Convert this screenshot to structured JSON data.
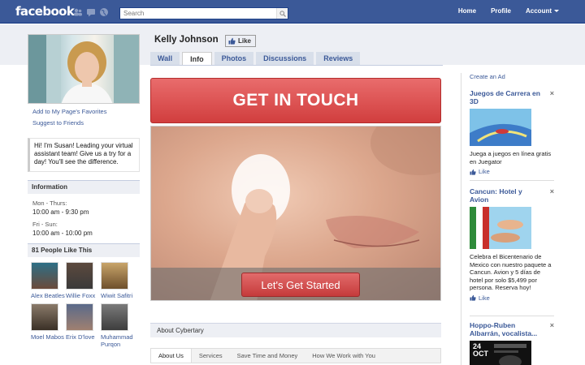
{
  "topbar": {
    "logo": "facebook",
    "search_placeholder": "Search",
    "nav": [
      "Home",
      "Profile",
      "Account"
    ]
  },
  "page": {
    "name": "Kelly Johnson",
    "like_label": "Like",
    "tabs": [
      "Wall",
      "Info",
      "Photos",
      "Discussions",
      "Reviews"
    ],
    "active_tab": "Info"
  },
  "left": {
    "links": [
      "Add to My Page's Favorites",
      "Suggest to Friends"
    ],
    "bio": "Hi! I'm Susan! Leading your virtual assistant team! Give us a try for a day! You'll see the difference.",
    "information_title": "Information",
    "hours": [
      {
        "days": "Mon - Thurs:",
        "time": "10:00 am - 9:30 pm"
      },
      {
        "days": "Fri - Sun:",
        "time": "10:00 am - 10:00 pm"
      }
    ],
    "people_title": "81 People Like This",
    "people": [
      "Alex Beatles",
      "Willie Foxx",
      "Wiwit Safitri",
      "Moel Mabos",
      "Erix D'love",
      "Muhammad Purqon"
    ]
  },
  "main": {
    "get_in_touch": "GET IN TOUCH",
    "cta": "Let's Get Started",
    "about_title": "About Cybertary",
    "subtabs": [
      "About Us",
      "Services",
      "Save Time and Money",
      "How We Work with You"
    ]
  },
  "ads": {
    "create_label": "Create an Ad",
    "items": [
      {
        "title": "Juegos de Carrera en 3D",
        "text": "Juega a juegos en línea gratis en Juegator",
        "like": "Like"
      },
      {
        "title": "Cancun: Hotel y Avion",
        "text": "Celebra el Bicentenario de Mexico con nuestro paquete a Cancun. Avion y 5 días de hotel por solo $5,499 por persona. Reserva hoy!",
        "like": "Like"
      },
      {
        "title": "Hoppo-Ruben Albarrán, vocalista...",
        "text": "",
        "like": ""
      }
    ],
    "poster_text": "24 OCT"
  },
  "colors": {
    "brand_blue": "#3b5998",
    "cta_red": "#d13e3e",
    "band_gray": "#edeff4"
  }
}
